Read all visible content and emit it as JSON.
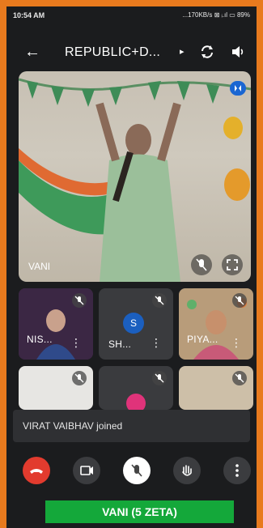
{
  "status": {
    "time": "10:54 AM",
    "right": "...170KB/s ⊠ ᵢ.ıl ▭ 89%"
  },
  "appbar": {
    "title": "REPUBLIC+D..."
  },
  "main": {
    "label": "VANI"
  },
  "tiles": [
    {
      "label": "NIS..."
    },
    {
      "label": "SH...",
      "avatar": "S"
    },
    {
      "label": "PIYA..."
    }
  ],
  "toast": "VIRAT VAIBHAV joined",
  "caption": "VANI (5 ZETA)",
  "colors": {
    "accent": "#14a83a",
    "end_call": "#e23b2e",
    "frame": "#e87a1e",
    "pin": "#1a66d2"
  },
  "icons": [
    "back-arrow-icon",
    "camera-switch-icon",
    "speaker-icon",
    "pin-icon",
    "mic-off-icon",
    "fullscreen-icon",
    "more-vert-icon",
    "end-call-icon",
    "video-icon",
    "hand-icon"
  ]
}
